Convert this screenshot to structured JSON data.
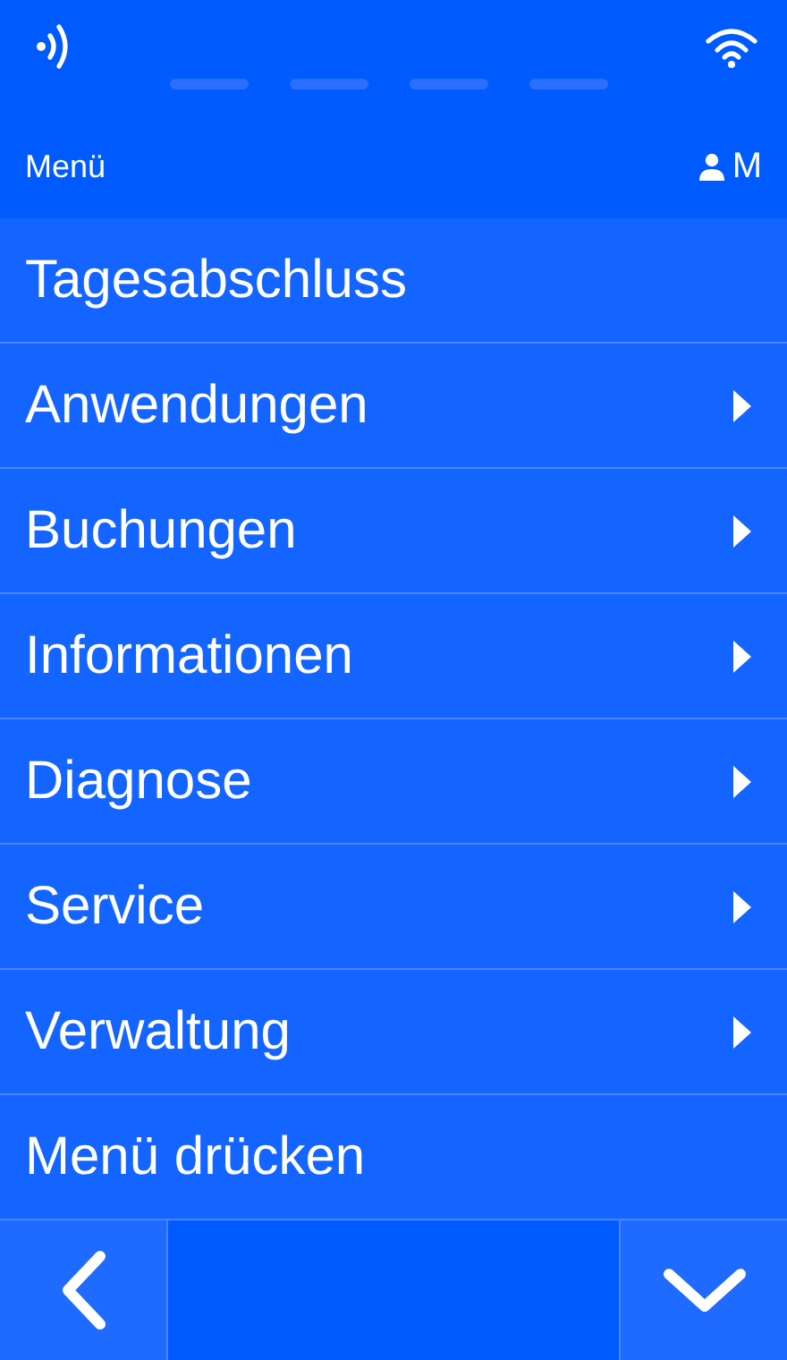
{
  "header": {
    "title": "Menü",
    "user": "M"
  },
  "menu": [
    {
      "label": "Tagesabschluss",
      "submenu": false
    },
    {
      "label": "Anwendungen",
      "submenu": true
    },
    {
      "label": "Buchungen",
      "submenu": true
    },
    {
      "label": "Informationen",
      "submenu": true
    },
    {
      "label": "Diagnose",
      "submenu": true
    },
    {
      "label": "Service",
      "submenu": true
    },
    {
      "label": "Verwaltung",
      "submenu": true
    },
    {
      "label": "Menü drücken",
      "submenu": false
    }
  ]
}
